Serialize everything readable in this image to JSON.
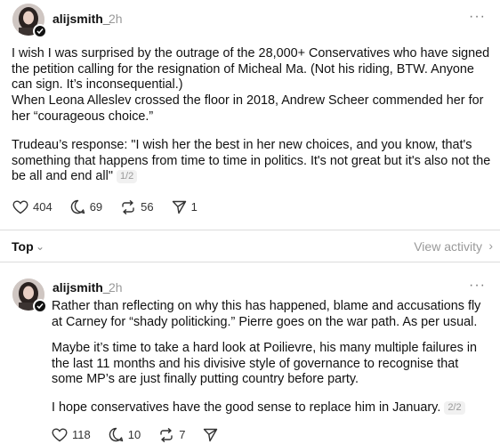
{
  "post1": {
    "username": "alijsmith_",
    "time": "2h",
    "more": "···",
    "paragraphs": [
      "I wish I was surprised by the outrage of the 28,000+ Conservatives who have signed the petition calling for the resignation of Micheal Ma. (Not his riding, BTW. Anyone can sign. It’s inconsequential.)",
      "When Leona Alleslev crossed the floor in 2018, Andrew Scheer commended her for her “courageous choice.”",
      "Trudeau’s response: \"I wish her the best in her new choices, and you know, that's something that happens from time to time in politics. It's not great but it's also not the be all and end all\""
    ],
    "pager": "1/2",
    "likes": "404",
    "replies": "69",
    "reposts": "56",
    "shares": "1"
  },
  "sort": {
    "label": "Top",
    "chevron": "⌄",
    "view_activity": "View activity",
    "view_chevron": "›"
  },
  "post2": {
    "username": "alijsmith_",
    "time": "2h",
    "more": "···",
    "paragraphs": [
      "Rather than reflecting on why this has happened, blame and accusations fly at Carney for “shady politicking.” Pierre goes on the war path. As per usual.",
      "Maybe it’s time to take a hard look at Poilievre, his many multiple failures in the last 11 months and his divisive style of governance to recognise that some MP’s are just finally putting country before party.",
      "I hope conservatives have the good sense to replace him in January."
    ],
    "pager": "2/2",
    "likes": "118",
    "replies": "10",
    "reposts": "7"
  },
  "icons": {
    "like": "heart-icon",
    "reply": "comment-icon",
    "repost": "repost-icon",
    "share": "send-icon",
    "verified": "verified-badge-icon"
  }
}
